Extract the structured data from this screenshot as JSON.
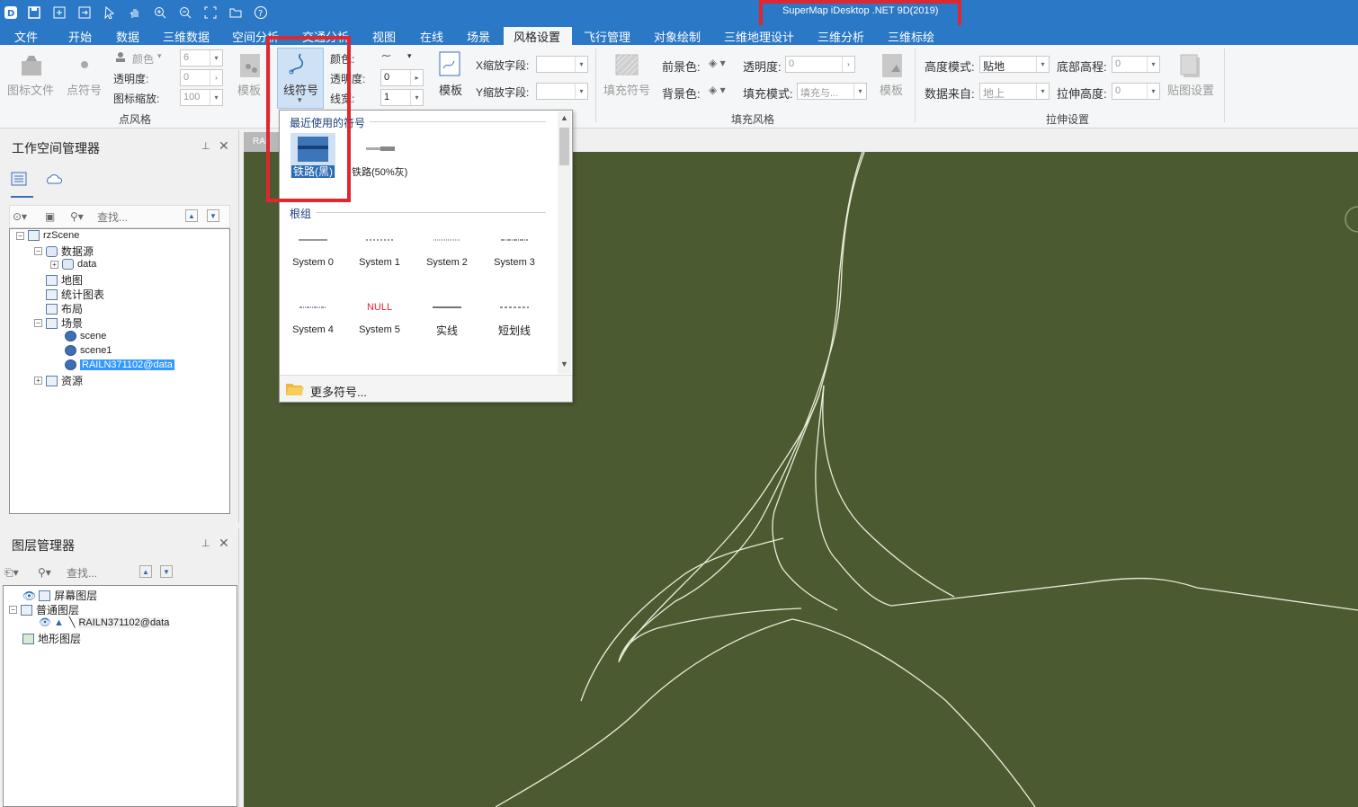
{
  "app": {
    "title": "SuperMap iDesktop .NET 9D(2019)"
  },
  "menu": {
    "items": [
      "文件",
      "开始",
      "数据",
      "三维数据",
      "空间分析",
      "交通分析",
      "视图",
      "在线",
      "场景",
      "风格设置",
      "飞行管理",
      "对象绘制",
      "三维地理设计",
      "三维分析",
      "三维标绘"
    ],
    "active": "风格设置"
  },
  "ribbon": {
    "point_group": {
      "title": "点风格",
      "symbol_file": "图标文件",
      "point_symbol": "点符号",
      "color_label": "颜色",
      "opacity_label": "透明度:",
      "scale_label": "图标缩放:",
      "size_value": "6",
      "opacity_value": "0",
      "scale_value": "100",
      "template": "模板"
    },
    "line_group": {
      "line_symbol": "线符号",
      "color_label": "颜色:",
      "opacity_label": "透明度:",
      "width_label": "线宽:",
      "opacity_value": "0",
      "width_value": "1",
      "template": "模板",
      "x_scale_label": "X缩放字段:",
      "y_scale_label": "Y缩放字段:"
    },
    "fill_group": {
      "title": "填充风格",
      "fill_symbol": "填充符号",
      "fg_label": "前景色:",
      "bg_label": "背景色:",
      "opacity_label": "透明度:",
      "opacity_value": "0",
      "fill_mode_label": "填充模式:",
      "fill_mode_value": "填充与...",
      "template": "模板"
    },
    "extrude_group": {
      "title": "拉伸设置",
      "height_mode_label": "高度模式:",
      "height_mode_value": "贴地",
      "data_from_label": "数据来自:",
      "data_from_value": "地上",
      "bottom_alt_label": "底部高程:",
      "bottom_alt_value": "0",
      "extrude_height_label": "拉伸高度:",
      "extrude_height_value": "0",
      "texture_settings": "贴图设置"
    }
  },
  "workspace": {
    "title": "工作空间管理器",
    "search_placeholder": "查找...",
    "nodes": {
      "root": "rzScene",
      "datasources": "数据源",
      "data": "data",
      "maps": "地图",
      "charts": "统计图表",
      "layouts": "布局",
      "scenes": "场景",
      "scene": "scene",
      "scene1": "scene1",
      "rail": "RAILN371102@data",
      "resources": "资源"
    }
  },
  "layers": {
    "title": "图层管理器",
    "search_placeholder": "查找...",
    "nodes": {
      "screen": "屏幕图层",
      "normal": "普通图层",
      "rail": "RAILN371102@data",
      "terrain": "地形图层"
    }
  },
  "map": {
    "tab_label": "RAI"
  },
  "popup": {
    "recent_title": "最近使用的符号",
    "recent": [
      "铁路(黑)",
      "铁路(50%灰)"
    ],
    "root_title": "根组",
    "symbols": [
      "System 0",
      "System 1",
      "System 2",
      "System 3",
      "System 4",
      "System 5",
      "实线",
      "短划线"
    ],
    "null_text": "NULL",
    "more": "更多符号..."
  },
  "colors": {
    "titlebar": "#2b78c6",
    "highlight_box": "#e0262f",
    "map_bg": "#4c5a31"
  }
}
